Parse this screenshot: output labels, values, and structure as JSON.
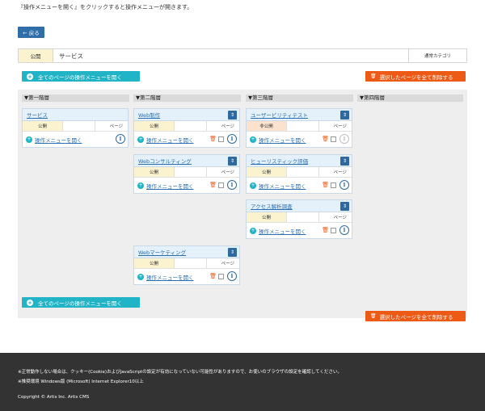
{
  "intro": "『操作メニューを開く』をクリックすると操作メニューが開きます。",
  "back_button": "← 戻る",
  "summary": {
    "status": "公開",
    "name": "サービス",
    "category": "通常カテゴリ"
  },
  "open_all_label": "全てのページの操作メニューを開く",
  "delete_selected_label": "選択したページを全て削除する",
  "columns": [
    "▼第一階層",
    "▼第二階層",
    "▼第三階層",
    "▼第四階層"
  ],
  "card_common": {
    "page_type": "ページ",
    "open_menu": "操作メニューを開く",
    "info": "i",
    "move": "⇕"
  },
  "cards": [
    {
      "title": "サービス",
      "status": "公開"
    },
    {
      "title": "Web制作",
      "status": "公開"
    },
    {
      "title": "ユーザービリティテスト",
      "status": "非公開"
    },
    {
      "title": "Webコンサルティング",
      "status": "公開"
    },
    {
      "title": "ヒューリスティック評価",
      "status": "公開"
    },
    {
      "title": "アクセス解析調査",
      "status": "公開"
    },
    {
      "title": "Webマーケティング",
      "status": "公開"
    }
  ],
  "footer": {
    "notice": "※正常動作しない場合は、クッキー(Cookie)およびJavaScriptの設定が有効になっていない可能性がありますので、お使いのブラウザの設定を確認してください。",
    "env": "※推奨環境 Windows版 (Microsoft) Internet Explorer10以上",
    "copyright": "Copyright © Artis Inc. Artis CMS"
  }
}
